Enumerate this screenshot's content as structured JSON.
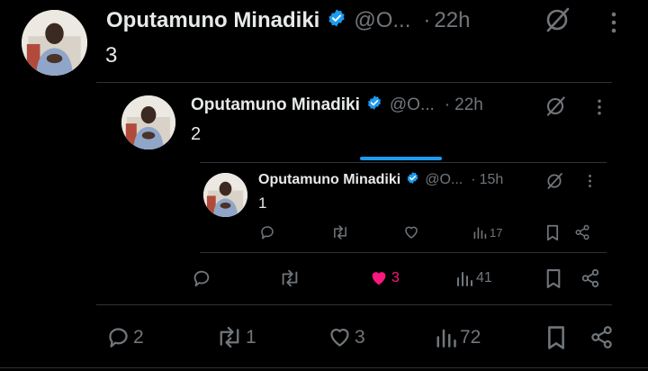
{
  "colors": {
    "background": "#000000",
    "text": "#e7e9ea",
    "muted": "#71767b",
    "verified": "#1d9bf0",
    "like": "#f91880",
    "divider": "#2f3336"
  },
  "tweet1": {
    "name": "Oputamuno Minadiki",
    "handle": "@O...",
    "dot": "·",
    "time": "22h",
    "body": "3",
    "icons": [
      "verified-badge-icon",
      "grok-icon",
      "more-icon"
    ]
  },
  "tweet2": {
    "name": "Oputamuno Minadiki",
    "handle": "@O...",
    "dot": "·",
    "time": "22h",
    "body": "2",
    "actions": {
      "reply": "",
      "retweet": "",
      "like": "3",
      "views": "41"
    }
  },
  "tweet3": {
    "name": "Oputamuno Minadiki",
    "handle": "@O...",
    "dot": "·",
    "time": "15h",
    "body": "1",
    "actions": {
      "reply": "",
      "retweet": "",
      "like": "",
      "views": "17"
    }
  },
  "tweet1_actions": {
    "reply": "2",
    "retweet": "1",
    "like": "3",
    "views": "72"
  }
}
